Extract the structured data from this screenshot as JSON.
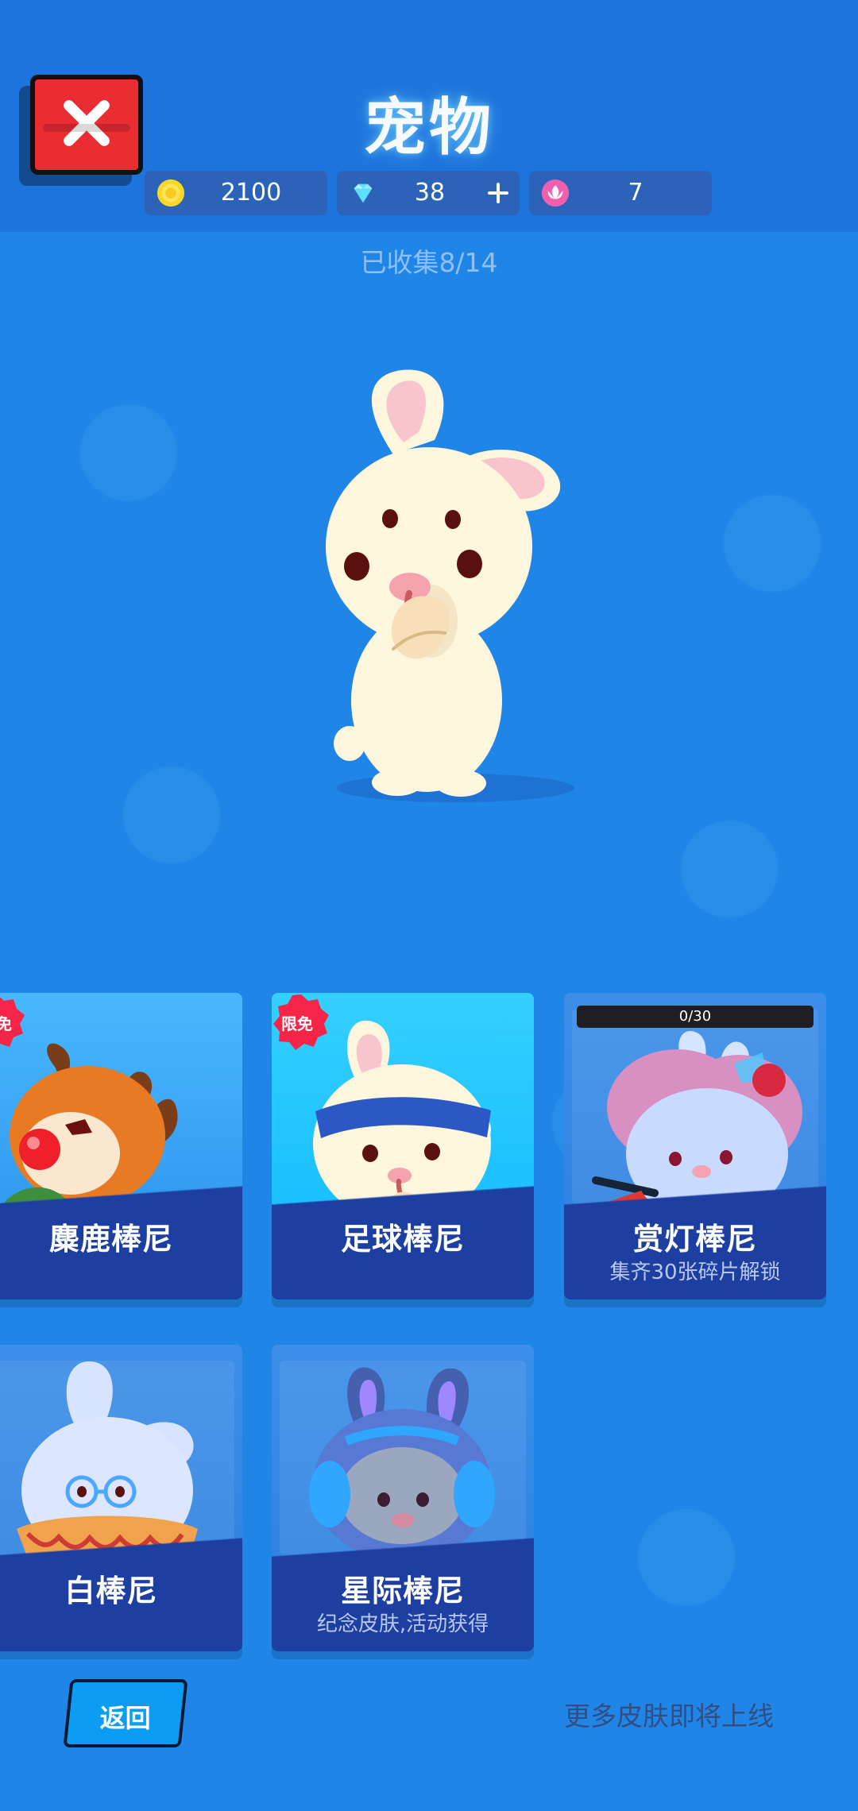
{
  "header": {
    "title": "宠物",
    "currencies": [
      {
        "icon": "coin-icon",
        "value": "2100"
      },
      {
        "icon": "diamond-icon",
        "value": "38"
      },
      {
        "icon": "lotus-icon",
        "value": "7"
      }
    ]
  },
  "collection": {
    "status": "已收集8/14"
  },
  "cards": [
    {
      "name": "麋鹿棒尼",
      "badge": "限免"
    },
    {
      "name": "足球棒尼",
      "badge": "限免"
    },
    {
      "name": "赏灯棒尼",
      "subtitle": "集齐30张碎片解锁",
      "progress": "0/30"
    },
    {
      "name": "白棒尼"
    },
    {
      "name": "星际棒尼",
      "subtitle": "纪念皮肤,活动获得"
    }
  ],
  "footer": {
    "return_label": "返回",
    "more_skins": "更多皮肤即将上线"
  },
  "colors": {
    "background": "#1f86e8",
    "header": "#1d74dc",
    "ribbon": "#1d3fa1",
    "close": "#ea2c33"
  }
}
